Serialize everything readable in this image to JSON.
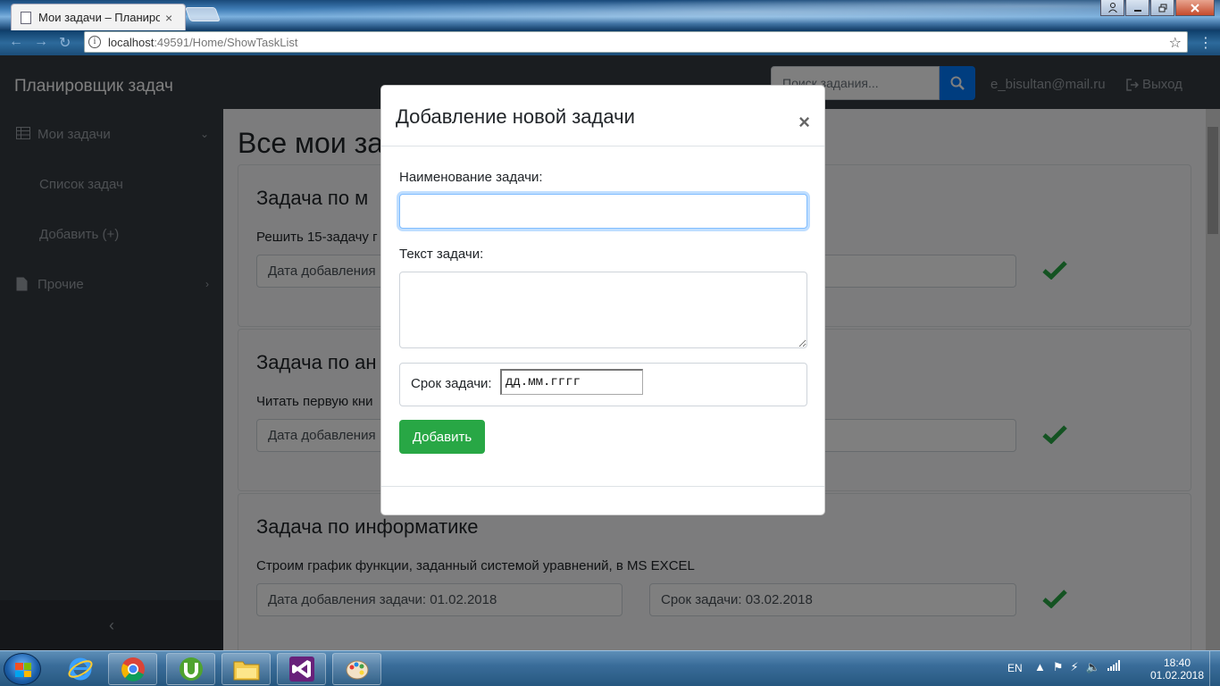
{
  "browser": {
    "tab_title": "Мои задачи – Планиров",
    "url_host": "localhost",
    "url_rest": ":49591/Home/ShowTaskList"
  },
  "header": {
    "brand": "Планировщик задач",
    "search_placeholder": "Поиск задания...",
    "user_email": "e_bisultan@mail.ru",
    "logout": "Выход"
  },
  "sidebar": {
    "my_tasks": "Мои задачи",
    "task_list": "Список задач",
    "add": "Добавить (+)",
    "other": "Прочие"
  },
  "main": {
    "title": "Все мои за",
    "cards": [
      {
        "title": "Задача по м",
        "text": "Решить 15-задачу г",
        "added": "Дата добавления",
        "due": ""
      },
      {
        "title": "Задача по ан",
        "text": "Читать первую кни",
        "added": "Дата добавления",
        "due": ""
      },
      {
        "title": "Задача по информатике",
        "text": "Строим график функции, заданный системой уравнений, в MS EXCEL",
        "added": "Дата добавления задачи: 01.02.2018",
        "due": "Срок задачи: 03.02.2018"
      }
    ]
  },
  "modal": {
    "title": "Добавление новой задачи",
    "close": "×",
    "name_label": "Наименование задачи:",
    "name_value": "",
    "text_label": "Текст задачи:",
    "text_value": "",
    "due_label": "Срок задачи:",
    "due_value": "дд.мм.гггг",
    "add_button": "Добавить"
  },
  "taskbar": {
    "lang": "EN",
    "time": "18:40",
    "date": "01.02.2018"
  },
  "colors": {
    "primary": "#007bff",
    "success": "#28a745",
    "dark": "#343a40"
  }
}
